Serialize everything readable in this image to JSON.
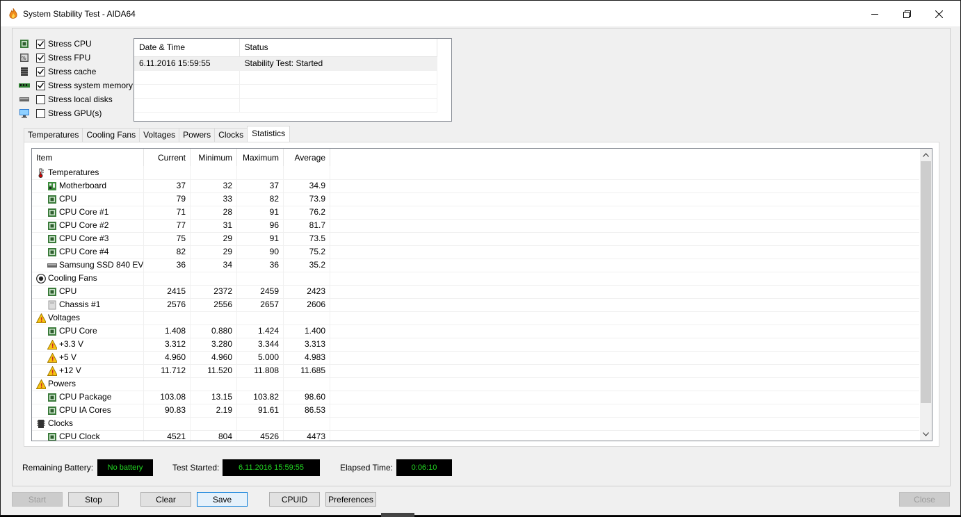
{
  "window": {
    "title": "System Stability Test - AIDA64"
  },
  "stress_options": [
    {
      "label": "Stress CPU",
      "checked": true,
      "icon": "cpu-icon"
    },
    {
      "label": "Stress FPU",
      "checked": true,
      "icon": "fpu-icon"
    },
    {
      "label": "Stress cache",
      "checked": true,
      "icon": "cache-icon"
    },
    {
      "label": "Stress system memory",
      "checked": true,
      "icon": "memory-icon"
    },
    {
      "label": "Stress local disks",
      "checked": false,
      "icon": "disk-icon"
    },
    {
      "label": "Stress GPU(s)",
      "checked": false,
      "icon": "gpu-icon"
    }
  ],
  "log": {
    "col_datetime": "Date & Time",
    "col_status": "Status",
    "rows": [
      {
        "datetime": "6.11.2016 15:59:55",
        "status": "Stability Test: Started"
      }
    ]
  },
  "tabs": [
    "Temperatures",
    "Cooling Fans",
    "Voltages",
    "Powers",
    "Clocks",
    "Statistics"
  ],
  "active_tab": "Statistics",
  "stats": {
    "headers": {
      "item": "Item",
      "current": "Current",
      "minimum": "Minimum",
      "maximum": "Maximum",
      "average": "Average"
    },
    "rows": [
      {
        "type": "group",
        "label": "Temperatures",
        "icon": "thermometer-icon"
      },
      {
        "type": "item",
        "label": "Motherboard",
        "icon": "motherboard-icon",
        "cur": "37",
        "min": "32",
        "max": "37",
        "avg": "34.9"
      },
      {
        "type": "item",
        "label": "CPU",
        "icon": "chip-icon",
        "cur": "79",
        "min": "33",
        "max": "82",
        "avg": "73.9"
      },
      {
        "type": "item",
        "label": "CPU Core #1",
        "icon": "chip-icon",
        "cur": "71",
        "min": "28",
        "max": "91",
        "avg": "76.2"
      },
      {
        "type": "item",
        "label": "CPU Core #2",
        "icon": "chip-icon",
        "cur": "77",
        "min": "31",
        "max": "96",
        "avg": "81.7"
      },
      {
        "type": "item",
        "label": "CPU Core #3",
        "icon": "chip-icon",
        "cur": "75",
        "min": "29",
        "max": "91",
        "avg": "73.5"
      },
      {
        "type": "item",
        "label": "CPU Core #4",
        "icon": "chip-icon",
        "cur": "82",
        "min": "29",
        "max": "90",
        "avg": "75.2"
      },
      {
        "type": "item",
        "label": "Samsung SSD 840 EV...",
        "icon": "drive-icon",
        "cur": "36",
        "min": "34",
        "max": "36",
        "avg": "35.2"
      },
      {
        "type": "group",
        "label": "Cooling Fans",
        "icon": "fan-icon"
      },
      {
        "type": "item",
        "label": "CPU",
        "icon": "chip-icon",
        "cur": "2415",
        "min": "2372",
        "max": "2459",
        "avg": "2423"
      },
      {
        "type": "item",
        "label": "Chassis #1",
        "icon": "chassis-icon",
        "cur": "2576",
        "min": "2556",
        "max": "2657",
        "avg": "2606"
      },
      {
        "type": "group",
        "label": "Voltages",
        "icon": "warning-icon"
      },
      {
        "type": "item",
        "label": "CPU Core",
        "icon": "chip-icon",
        "cur": "1.408",
        "min": "0.880",
        "max": "1.424",
        "avg": "1.400"
      },
      {
        "type": "item",
        "label": "+3.3 V",
        "icon": "warning-icon",
        "cur": "3.312",
        "min": "3.280",
        "max": "3.344",
        "avg": "3.313"
      },
      {
        "type": "item",
        "label": "+5 V",
        "icon": "warning-icon",
        "cur": "4.960",
        "min": "4.960",
        "max": "5.000",
        "avg": "4.983"
      },
      {
        "type": "item",
        "label": "+12 V",
        "icon": "warning-icon",
        "cur": "11.712",
        "min": "11.520",
        "max": "11.808",
        "avg": "11.685"
      },
      {
        "type": "group",
        "label": "Powers",
        "icon": "warning-icon"
      },
      {
        "type": "item",
        "label": "CPU Package",
        "icon": "chip-icon",
        "cur": "103.08",
        "min": "13.15",
        "max": "103.82",
        "avg": "98.60"
      },
      {
        "type": "item",
        "label": "CPU IA Cores",
        "icon": "chip-icon",
        "cur": "90.83",
        "min": "2.19",
        "max": "91.61",
        "avg": "86.53"
      },
      {
        "type": "group",
        "label": "Clocks",
        "icon": "clock-icon"
      },
      {
        "type": "item",
        "label": "CPU Clock",
        "icon": "chip-icon",
        "cur": "4521",
        "min": "804",
        "max": "4526",
        "avg": "4473"
      }
    ]
  },
  "status": {
    "battery_label": "Remaining Battery:",
    "battery_value": "No battery",
    "started_label": "Test Started:",
    "started_value": "6.11.2016 15:59:55",
    "elapsed_label": "Elapsed Time:",
    "elapsed_value": "0:06:10"
  },
  "buttons": {
    "start": "Start",
    "stop": "Stop",
    "clear": "Clear",
    "save": "Save",
    "cpuid": "CPUID",
    "preferences": "Preferences",
    "close": "Close"
  },
  "colors": {
    "status_text": "#22d822",
    "status_bg": "#000000",
    "focus_border": "#0078d7"
  }
}
